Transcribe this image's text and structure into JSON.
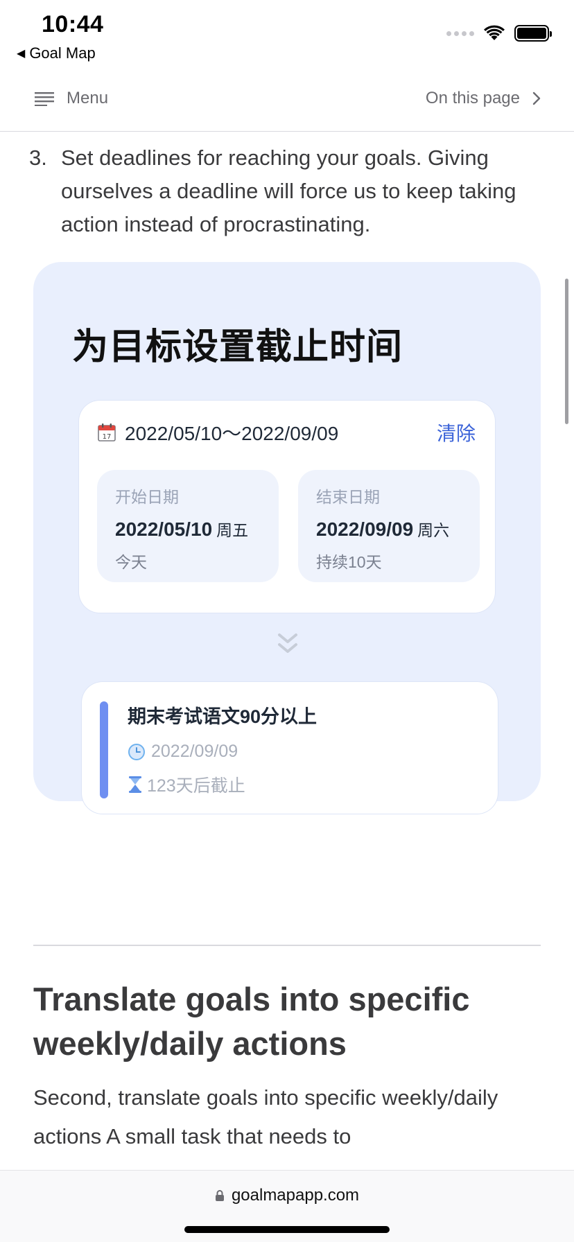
{
  "status_bar": {
    "time": "10:44",
    "back_app": "Goal Map"
  },
  "navbar": {
    "menu_label": "Menu",
    "on_this_page_label": "On this page"
  },
  "article": {
    "list_item_number": "3.",
    "list_item_text": "Set deadlines for reaching your goals. Giving ourselves a deadline will force us to keep taking action instead of procrastinating.",
    "illustration": {
      "title": "为目标设置截止时间",
      "date_range": "2022/05/10～2022/09/09",
      "clear_label": "清除",
      "start": {
        "label": "开始日期",
        "date": "2022/05/10",
        "weekday": "周五",
        "note": "今天"
      },
      "end": {
        "label": "结束日期",
        "date": "2022/09/09",
        "weekday": "周六",
        "note": "持续10天"
      },
      "goal": {
        "title": "期末考试语文90分以上",
        "date": "2022/09/09",
        "deadline": "123天后截止",
        "accent_color": "#6f8ff1"
      }
    },
    "heading": "Translate goals into specific weekly/daily actions",
    "paragraph": "Second, translate goals into specific weekly/daily actions A small task that needs to"
  },
  "bottom_bar": {
    "url": "goalmapapp.com"
  },
  "colors": {
    "illustration_bg": "#e9effd",
    "link_blue": "#3a62d8"
  }
}
